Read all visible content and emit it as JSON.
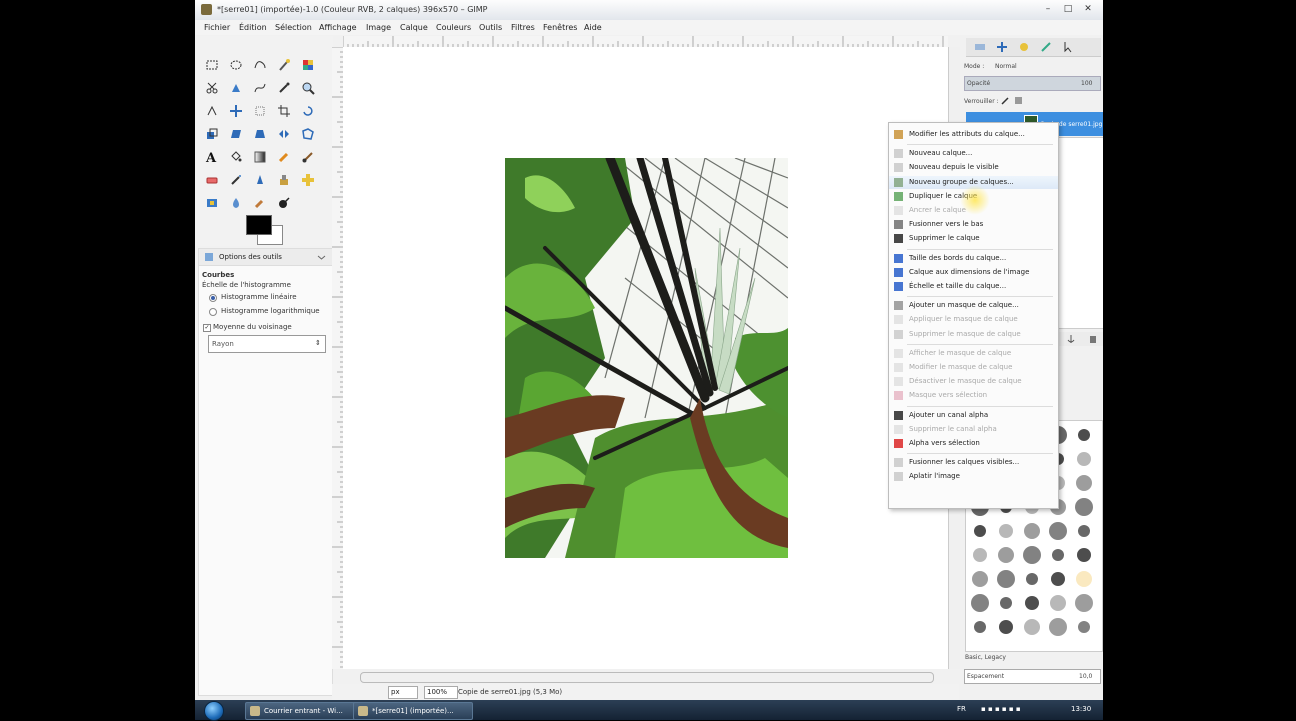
{
  "window": {
    "title": "*[serre01] (importée)-1.0 (Couleur RVB, 2 calques) 396x570 – GIMP",
    "minimize": "–",
    "maximize": "□",
    "close": "✕"
  },
  "menubar": [
    "Fichier",
    "Édition",
    "Sélection",
    "Affichage",
    "Image",
    "Calque",
    "Couleurs",
    "Outils",
    "Filtres",
    "Fenêtres",
    "Aide"
  ],
  "tool_options": {
    "tab_label": "Options des outils",
    "tool_name": "Courbes",
    "histogram_scale_label": "Échelle de l'histogramme",
    "linear_label": "Histogramme linéaire",
    "log_label": "Histogramme logarithmique",
    "linear_selected": true,
    "averaging_label": "Moyenne du voisinage",
    "averaging_checked": true,
    "averaging_value": "Rayon"
  },
  "status": {
    "unit": "px",
    "zoom": "100%",
    "info": "Copie de serre01.jpg (5,3 Mo)"
  },
  "layers_dock": {
    "mode_label": "Mode :",
    "mode_value": "Normal",
    "opacity_label": "Opacité",
    "opacity_value": "100",
    "lock_label": "Verrouiller :",
    "layer_name": "Copie de serre01.jpg",
    "brush_name": "Basic, Legacy",
    "spacing_label": "Espacement",
    "spacing_value": "10,0"
  },
  "context_menu": [
    {
      "label": "Modifier les attributs du calque...",
      "disabled": false,
      "sep_before": false
    },
    {
      "label": "Nouveau calque...",
      "disabled": false,
      "sep_before": true
    },
    {
      "label": "Nouveau depuis le visible",
      "disabled": false,
      "sep_before": false
    },
    {
      "label": "Nouveau groupe de calques...",
      "disabled": false,
      "sep_before": false,
      "hover": true
    },
    {
      "label": "Dupliquer le calque",
      "disabled": false,
      "sep_before": false
    },
    {
      "label": "Ancrer le calque",
      "disabled": true,
      "sep_before": false
    },
    {
      "label": "Fusionner vers le bas",
      "disabled": false,
      "sep_before": false
    },
    {
      "label": "Supprimer le calque",
      "disabled": false,
      "sep_before": false
    },
    {
      "label": "Taille des bords du calque...",
      "disabled": false,
      "sep_before": true
    },
    {
      "label": "Calque aux dimensions de l'image",
      "disabled": false,
      "sep_before": false
    },
    {
      "label": "Échelle et taille du calque...",
      "disabled": false,
      "sep_before": false
    },
    {
      "label": "Ajouter un masque de calque...",
      "disabled": false,
      "sep_before": true
    },
    {
      "label": "Appliquer le masque de calque",
      "disabled": true,
      "sep_before": false
    },
    {
      "label": "Supprimer le masque de calque",
      "disabled": true,
      "sep_before": false
    },
    {
      "label": "Afficher le masque de calque",
      "disabled": true,
      "sep_before": true
    },
    {
      "label": "Modifier le masque de calque",
      "disabled": true,
      "sep_before": false
    },
    {
      "label": "Désactiver le masque de calque",
      "disabled": true,
      "sep_before": false
    },
    {
      "label": "Masque vers sélection",
      "disabled": true,
      "sep_before": false
    },
    {
      "label": "Ajouter un canal alpha",
      "disabled": false,
      "sep_before": true
    },
    {
      "label": "Supprimer le canal alpha",
      "disabled": true,
      "sep_before": false
    },
    {
      "label": "Alpha vers sélection",
      "disabled": false,
      "sep_before": false
    },
    {
      "label": "Fusionner les calques visibles...",
      "disabled": false,
      "sep_before": true
    },
    {
      "label": "Aplatir l'image",
      "disabled": false,
      "sep_before": false
    }
  ],
  "taskbar": {
    "tasks": [
      "Courrier entrant - Wi...",
      "*[serre01] (importée)..."
    ],
    "lang": "FR",
    "clock": "13:30"
  },
  "colors": {
    "accent": "#3d8fe0",
    "foreground": "#000000",
    "background": "#ffffff"
  }
}
